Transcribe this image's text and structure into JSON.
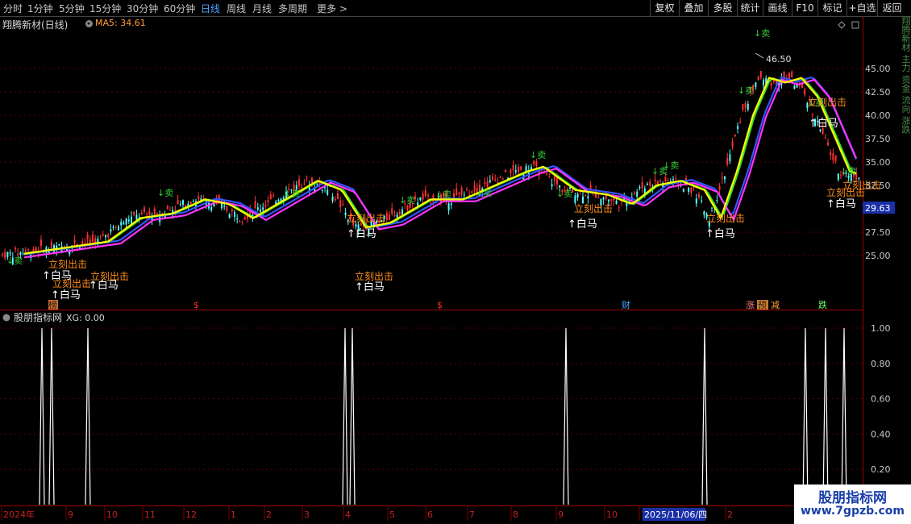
{
  "toolbar": {
    "periods": [
      "分时",
      "1分钟",
      "5分钟",
      "15分钟",
      "30分钟",
      "60分钟",
      "日线",
      "周线",
      "月线",
      "多周期",
      "更多 >"
    ],
    "active_period": "日线",
    "buttons": [
      "复权",
      "叠加",
      "多股",
      "统计",
      "画线",
      "F10",
      "标记",
      "+自选",
      "返回"
    ]
  },
  "main_panel": {
    "stock_title": "翔腾新材(日线)",
    "ma_label": "MA5: 34.61",
    "diamond_icon": "diamond-icon",
    "square_icon": "window-icon",
    "high_label": "46.50",
    "current_price": "29.63",
    "y_ticks": [
      "45.00",
      "42.50",
      "40.00",
      "37.50",
      "35.00",
      "32.50",
      "27.50",
      "25.00"
    ],
    "sell_label": "↓卖",
    "buy_label": "↑白马",
    "exit_label": "立刻出击",
    "event_markers": [
      "榜",
      "$",
      "$",
      "财",
      "涨",
      "预",
      "减",
      "跌"
    ]
  },
  "indicator_panel": {
    "title": "股朋指标网",
    "xg_label": "XG: 0.00",
    "y_ticks": [
      "1.00",
      "0.80",
      "0.60",
      "0.40",
      "0.20"
    ]
  },
  "date_axis": {
    "labels": [
      "2024年",
      "9",
      "10",
      "11",
      "12",
      "1",
      "2",
      "3",
      "4",
      "5",
      "6",
      "7",
      "8",
      "9",
      "10",
      "1",
      "2"
    ],
    "highlight_date": "2025/11/06/四"
  },
  "right_strip_text": "翔腾新材 主力 资金 流向 涨跌",
  "watermark": {
    "line1": "股朋指标网",
    "line2": "www.7gpzb.com"
  },
  "colors": {
    "up": "#ff3232",
    "down": "#54ffff",
    "ma_yellow": "#ffff00",
    "ma_magenta": "#ff33ff",
    "ma_blue": "#3355ff",
    "ma_green": "#33dd33",
    "sell_green": "#33cc33",
    "exit_orange": "#ff8c1a"
  }
}
